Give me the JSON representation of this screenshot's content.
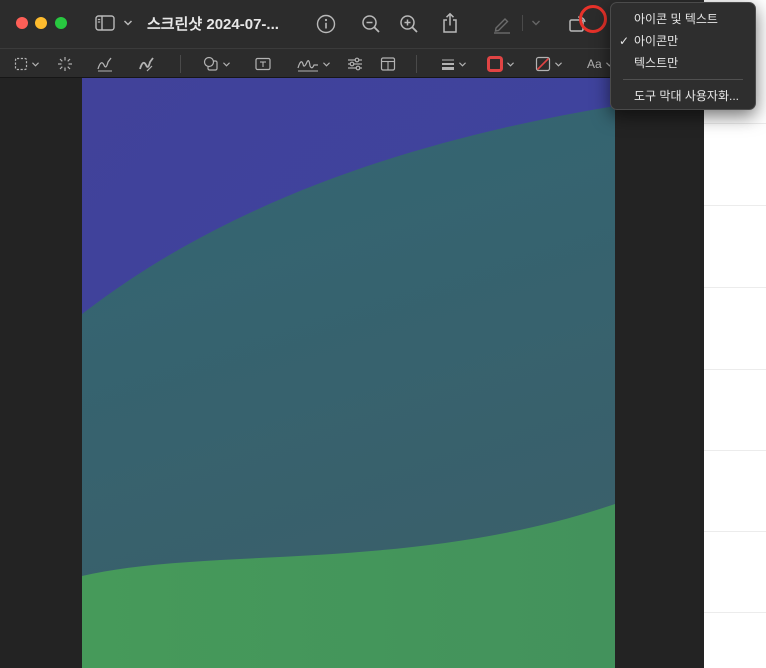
{
  "window": {
    "title": "스크린샷 2024-07-..."
  },
  "view_menu": {
    "items": [
      {
        "label": "아이콘 및 텍스트",
        "checked": false
      },
      {
        "label": "아이콘만",
        "checked": true
      },
      {
        "label": "텍스트만",
        "checked": false
      },
      {
        "label": "도구 막대 사용자화...",
        "checked": false
      }
    ],
    "check_mark": "✓"
  },
  "markup": {
    "text_style_label": "Aa"
  },
  "document": {
    "colors": {
      "top": "#41429a",
      "middle": "#336673",
      "bottom": "#469a5a"
    }
  },
  "colors": {
    "highlight": "#e8322a",
    "shape_border": "#e04444",
    "close": "#fe5f57",
    "minimize": "#febc2e",
    "zoom": "#28c840"
  }
}
